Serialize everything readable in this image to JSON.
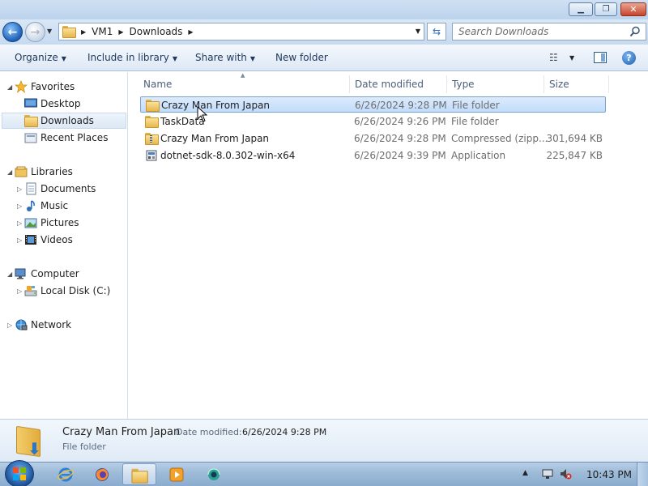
{
  "address": {
    "crumbs": [
      "VM1",
      "Downloads"
    ]
  },
  "search": {
    "placeholder": "Search Downloads"
  },
  "toolbar": {
    "organize": "Organize",
    "include_in_library": "Include in library",
    "share_with": "Share with",
    "new_folder": "New folder"
  },
  "nav": {
    "favorites": "Favorites",
    "desktop": "Desktop",
    "downloads": "Downloads",
    "recent_places": "Recent Places",
    "libraries": "Libraries",
    "documents": "Documents",
    "music": "Music",
    "pictures": "Pictures",
    "videos": "Videos",
    "computer": "Computer",
    "local_disk": "Local Disk (C:)",
    "network": "Network"
  },
  "columns": {
    "name": "Name",
    "date_modified": "Date modified",
    "type": "Type",
    "size": "Size"
  },
  "files": [
    {
      "name": "Crazy Man From Japan",
      "date": "6/26/2024 9:28 PM",
      "type": "File folder",
      "size": "",
      "icon": "folder-icon",
      "selected": true
    },
    {
      "name": "TaskData",
      "date": "6/26/2024 9:26 PM",
      "type": "File folder",
      "size": "",
      "icon": "folder-icon",
      "selected": false
    },
    {
      "name": "Crazy Man From Japan",
      "date": "6/26/2024 9:28 PM",
      "type": "Compressed (zipp...",
      "size": "301,694 KB",
      "icon": "zip-folder-icon",
      "selected": false
    },
    {
      "name": "dotnet-sdk-8.0.302-win-x64",
      "date": "6/26/2024 9:39 PM",
      "type": "Application",
      "size": "225,847 KB",
      "icon": "installer-icon",
      "selected": false
    }
  ],
  "details": {
    "name": "Crazy Man From Japan",
    "date_label": "Date modified:",
    "date": "6/26/2024 9:28 PM",
    "type": "File folder"
  },
  "taskbar": {
    "clock": "10:43 PM",
    "apps": [
      "internet-explorer-icon",
      "firefox-icon",
      "windows-explorer-icon",
      "media-player-icon",
      "network-app-icon"
    ]
  },
  "colors": {
    "selection_bg": "#c1dcfc",
    "selection_border": "#7da2ce",
    "toolbar_text": "#1e395b",
    "accent_blue": "#1d5fb5"
  }
}
